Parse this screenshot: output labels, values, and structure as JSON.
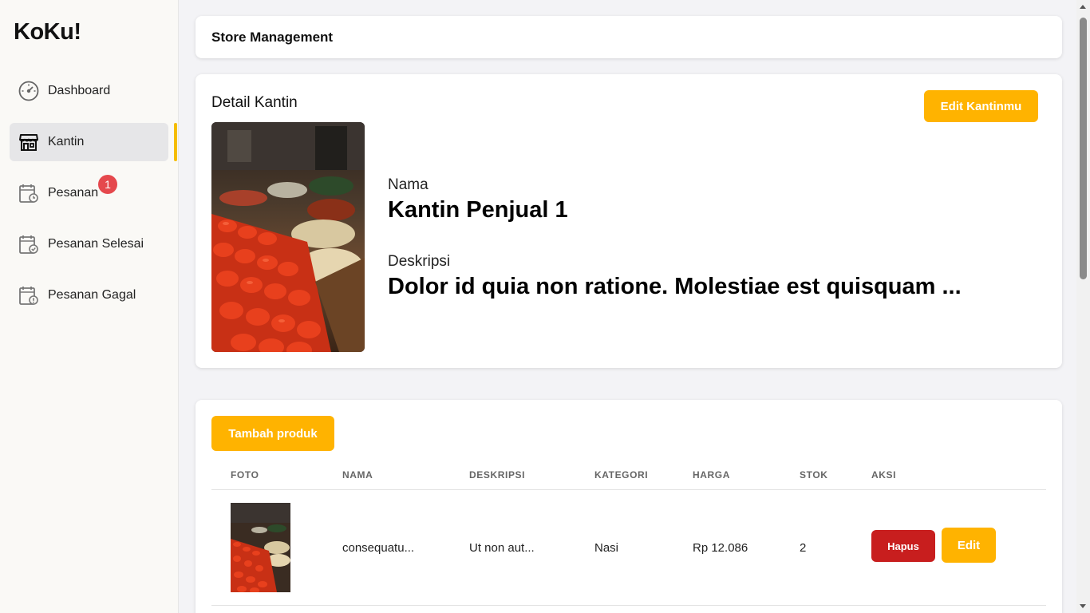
{
  "app": {
    "logo": "KoKu!"
  },
  "sidebar": {
    "items": [
      {
        "label": "Dashboard",
        "icon": "gauge-icon"
      },
      {
        "label": "Kantin",
        "icon": "store-icon",
        "active": true
      },
      {
        "label": "Pesanan",
        "icon": "calendar-clock-icon",
        "badge": "1"
      },
      {
        "label": "Pesanan Selesai",
        "icon": "calendar-check-icon"
      },
      {
        "label": "Pesanan Gagal",
        "icon": "calendar-alert-icon"
      }
    ]
  },
  "header": {
    "title": "Store Management"
  },
  "detail": {
    "title": "Detail Kantin",
    "edit_label": "Edit Kantinmu",
    "name_label": "Nama",
    "name_value": "Kantin Penjual 1",
    "desc_label": "Deskripsi",
    "desc_value": "Dolor id quia non ratione. Molestiae est quisquam ..."
  },
  "products": {
    "add_label": "Tambah produk",
    "columns": [
      "FOTO",
      "NAMA",
      "DESKRIPSI",
      "KATEGORI",
      "HARGA",
      "STOK",
      "AKSI"
    ],
    "rows": [
      {
        "nama": "consequatu...",
        "deskripsi": "Ut non aut...",
        "kategori": "Nasi",
        "harga": "Rp 12.086",
        "stok": "2",
        "hapus_label": "Hapus",
        "edit_label": "Edit"
      }
    ]
  },
  "colors": {
    "accent": "#ffb300",
    "danger": "#c81e1e",
    "badge": "#e5484d",
    "active_bar": "#f5bd00"
  }
}
